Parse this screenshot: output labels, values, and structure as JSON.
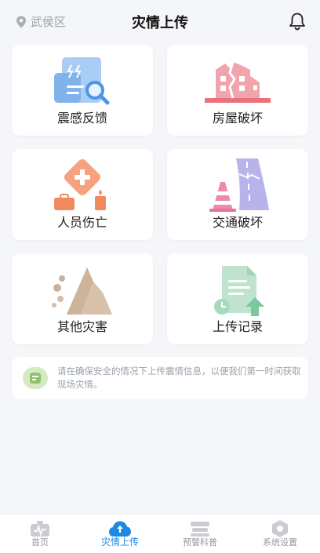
{
  "header": {
    "location": "武侯区",
    "title": "灾情上传"
  },
  "cards": [
    {
      "label": "震感反馈",
      "icon": "document-search-icon"
    },
    {
      "label": "房屋破坏",
      "icon": "cracked-building-icon"
    },
    {
      "label": "人员伤亡",
      "icon": "medical-cross-icon"
    },
    {
      "label": "交通破坏",
      "icon": "cracked-road-icon"
    },
    {
      "label": "其他灾害",
      "icon": "landslide-icon"
    },
    {
      "label": "上传记录",
      "icon": "upload-record-icon"
    }
  ],
  "tip": {
    "text": "请在确保安全的情况下上传震情信息，以便我们第一时间获取现场灾情。"
  },
  "tabbar": {
    "items": [
      {
        "label": "首页",
        "active": false
      },
      {
        "label": "灾情上传",
        "active": true
      },
      {
        "label": "预警科普",
        "active": false
      },
      {
        "label": "系统设置",
        "active": false
      }
    ]
  },
  "colors": {
    "accent": "#1e88e5",
    "background": "#f4f6f9"
  }
}
